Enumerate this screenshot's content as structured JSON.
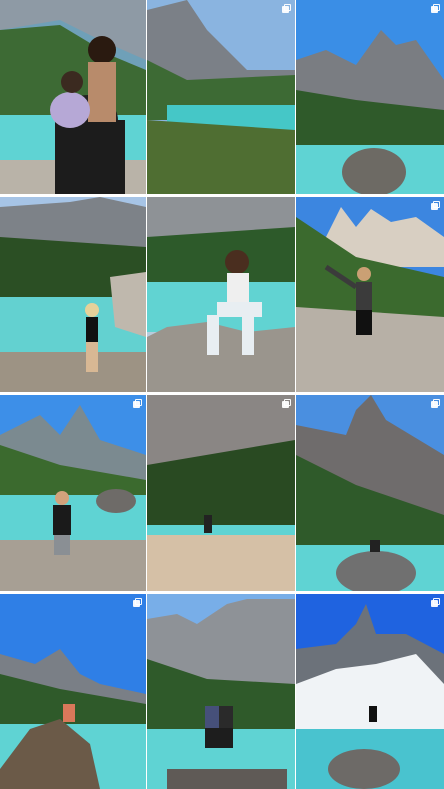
{
  "grid": {
    "posts": [
      {
        "id": "post-1",
        "scene": "woman-holding-child-by-lake",
        "multiple": false
      },
      {
        "id": "post-2",
        "scene": "man-on-rock-trees-mountain",
        "multiple": true
      },
      {
        "id": "post-3",
        "scene": "mountain-peak-rock-in-lake",
        "multiple": true
      },
      {
        "id": "post-4",
        "scene": "woman-standing-lake-shore",
        "multiple": false
      },
      {
        "id": "post-5",
        "scene": "woman-sitting-on-rocks",
        "multiple": false
      },
      {
        "id": "post-6",
        "scene": "woman-waving-trail",
        "multiple": true
      },
      {
        "id": "post-7",
        "scene": "man-standing-lake-shore",
        "multiple": true
      },
      {
        "id": "post-8",
        "scene": "person-far-cliffs-lake",
        "multiple": true
      },
      {
        "id": "post-9",
        "scene": "person-on-rock-mountain",
        "multiple": true
      },
      {
        "id": "post-10",
        "scene": "person-on-big-rock-lake",
        "multiple": true
      },
      {
        "id": "post-11",
        "scene": "couple-on-rock-lake",
        "multiple": false
      },
      {
        "id": "post-12",
        "scene": "person-on-rock-snowy-peak",
        "multiple": true
      }
    ]
  },
  "colors": {
    "lake": "#5fd3d3",
    "sky": "#2e7fe0",
    "forest": "#2f5a2a",
    "rock": "#8e8f92"
  }
}
